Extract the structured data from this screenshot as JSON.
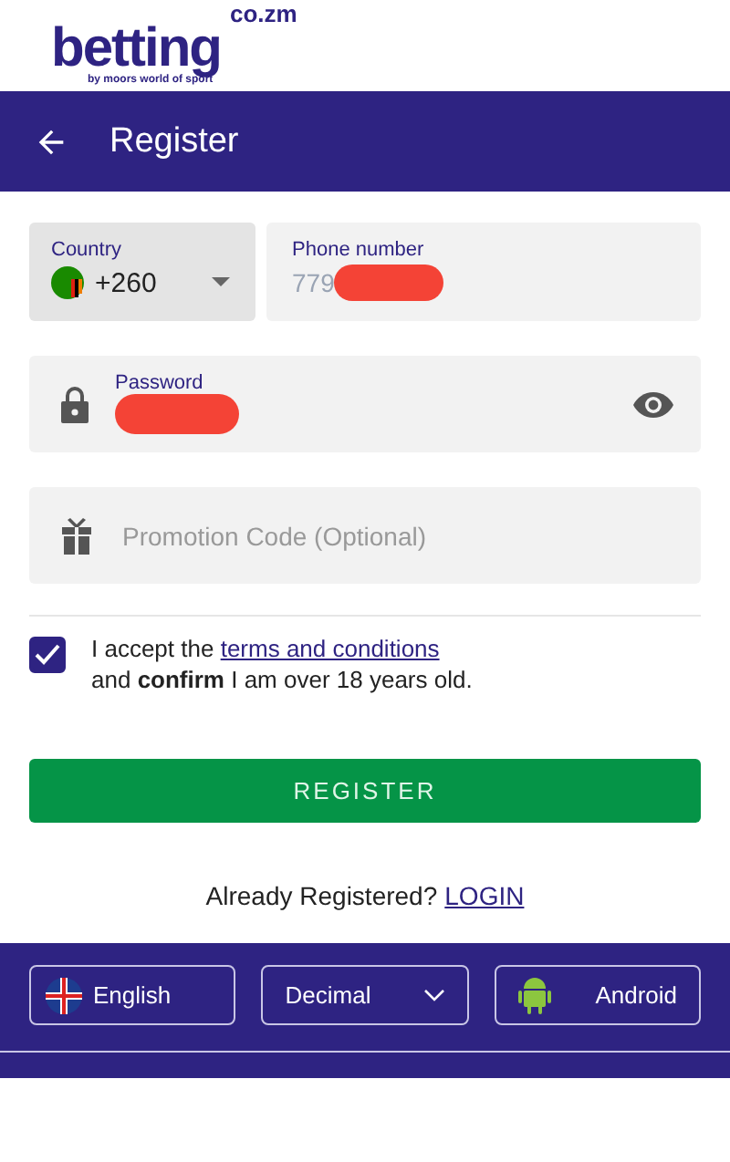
{
  "logo": {
    "name": "betting",
    "suffix": "co.zm",
    "tagline": "by moors world of sport"
  },
  "header": {
    "title": "Register"
  },
  "country": {
    "label": "Country",
    "code": "+260"
  },
  "phone": {
    "label": "Phone number",
    "value": "779",
    "redacted": true
  },
  "password": {
    "label": "Password",
    "redacted": true
  },
  "promo": {
    "placeholder": "Promotion Code (Optional)"
  },
  "terms": {
    "checked": true,
    "text_before": "I accept the ",
    "link": "terms and conditions",
    "text_after": "and **confirm** I am over 18 years old."
  },
  "register_button": "REGISTER",
  "login": {
    "text": "Already Registered?",
    "link": "LOGIN"
  },
  "footer": {
    "language": "English",
    "odds": "Decimal",
    "app": "Android"
  }
}
